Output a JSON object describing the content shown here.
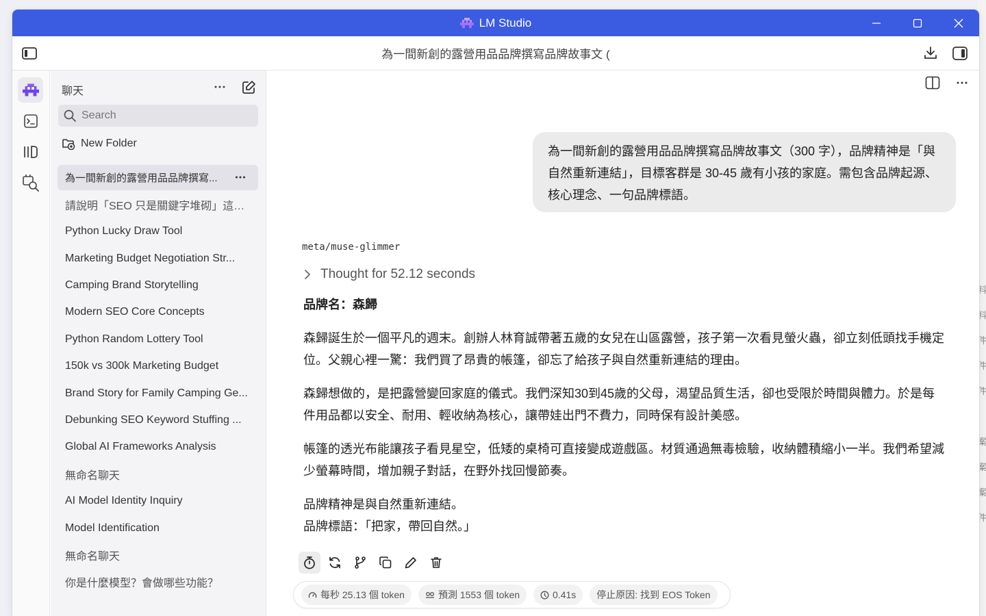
{
  "app": {
    "title": "LM Studio",
    "accent_color": "#3b5be0"
  },
  "toolbar": {
    "chat_title": "為一間新創的露營用品品牌撰寫品牌故事文 ("
  },
  "rail": {
    "items": [
      {
        "icon": "lm-studio-logo-icon",
        "active": true
      },
      {
        "icon": "terminal-icon"
      },
      {
        "icon": "library-icon"
      },
      {
        "icon": "discover-search-icon"
      }
    ]
  },
  "sidebar": {
    "header_label": "聊天",
    "search_placeholder": "Search",
    "new_folder_label": "New Folder",
    "chats": [
      {
        "title": "為一間新創的露營用品品牌撰寫...",
        "active": true
      },
      {
        "title": "請說明「SEO 只是關鍵字堆砌」這個..."
      },
      {
        "title": "Python Lucky Draw Tool"
      },
      {
        "title": "Marketing Budget Negotiation Str..."
      },
      {
        "title": "Camping Brand Storytelling"
      },
      {
        "title": "Modern SEO Core Concepts"
      },
      {
        "title": "Python Random Lottery Tool"
      },
      {
        "title": "150k vs 300k Marketing Budget"
      },
      {
        "title": "Brand Story for Family Camping Ge..."
      },
      {
        "title": "Debunking SEO Keyword Stuffing ..."
      },
      {
        "title": "Global AI Frameworks Analysis"
      },
      {
        "title": "無命名聊天"
      },
      {
        "title": "AI Model Identity Inquiry"
      },
      {
        "title": "Model Identification"
      },
      {
        "title": "無命名聊天"
      },
      {
        "title": "你是什麼模型？會做哪些功能？"
      }
    ]
  },
  "conversation": {
    "user_message": "為一間新創的露營用品品牌撰寫品牌故事文（300 字），品牌精神是「與自然重新連結」，目標客群是 30-45 歲有小孩的家庭。需包含品牌起源、核心理念、一句品牌標語。",
    "model_name": "meta/muse-glimmer",
    "thought_label": "Thought for 52.12 seconds",
    "response": {
      "brand_line": "品牌名：森歸",
      "paragraphs": [
        "森歸誕生於一個平凡的週末。創辦人林育誠帶著五歲的女兒在山區露營，孩子第一次看見螢火蟲，卻立刻低頭找手機定位。父親心裡一驚：我們買了昂貴的帳篷，卻忘了給孩子與自然重新連結的理由。",
        "森歸想做的，是把露營變回家庭的儀式。我們深知30到45歲的父母，渴望品質生活，卻也受限於時間與體力。於是每件用品都以安全、耐用、輕收納為核心，讓帶娃出門不費力，同時保有設計美感。",
        "帳篷的透光布能讓孩子看見星空，低矮的桌椅可直接變成遊戲區。材質通過無毒檢驗，收納體積縮小一半。我們希望減少螢幕時間，增加親子對話，在野外找回慢節奏。",
        "品牌精神是與自然重新連結。\n品牌標語：「把家，帶回自然。」"
      ]
    },
    "stats": {
      "tokens_per_second": "每秒 25.13 個 token",
      "predicted_tokens": "預測 1553 個 token",
      "time_to_first": "0.41s",
      "stop_reason": "停止原因: 找到 EOS Token"
    }
  },
  "desktop": {
    "edge_glyphs": [
      "料",
      "料",
      "件",
      "件",
      "件",
      "案",
      "案",
      "案",
      "件"
    ]
  }
}
